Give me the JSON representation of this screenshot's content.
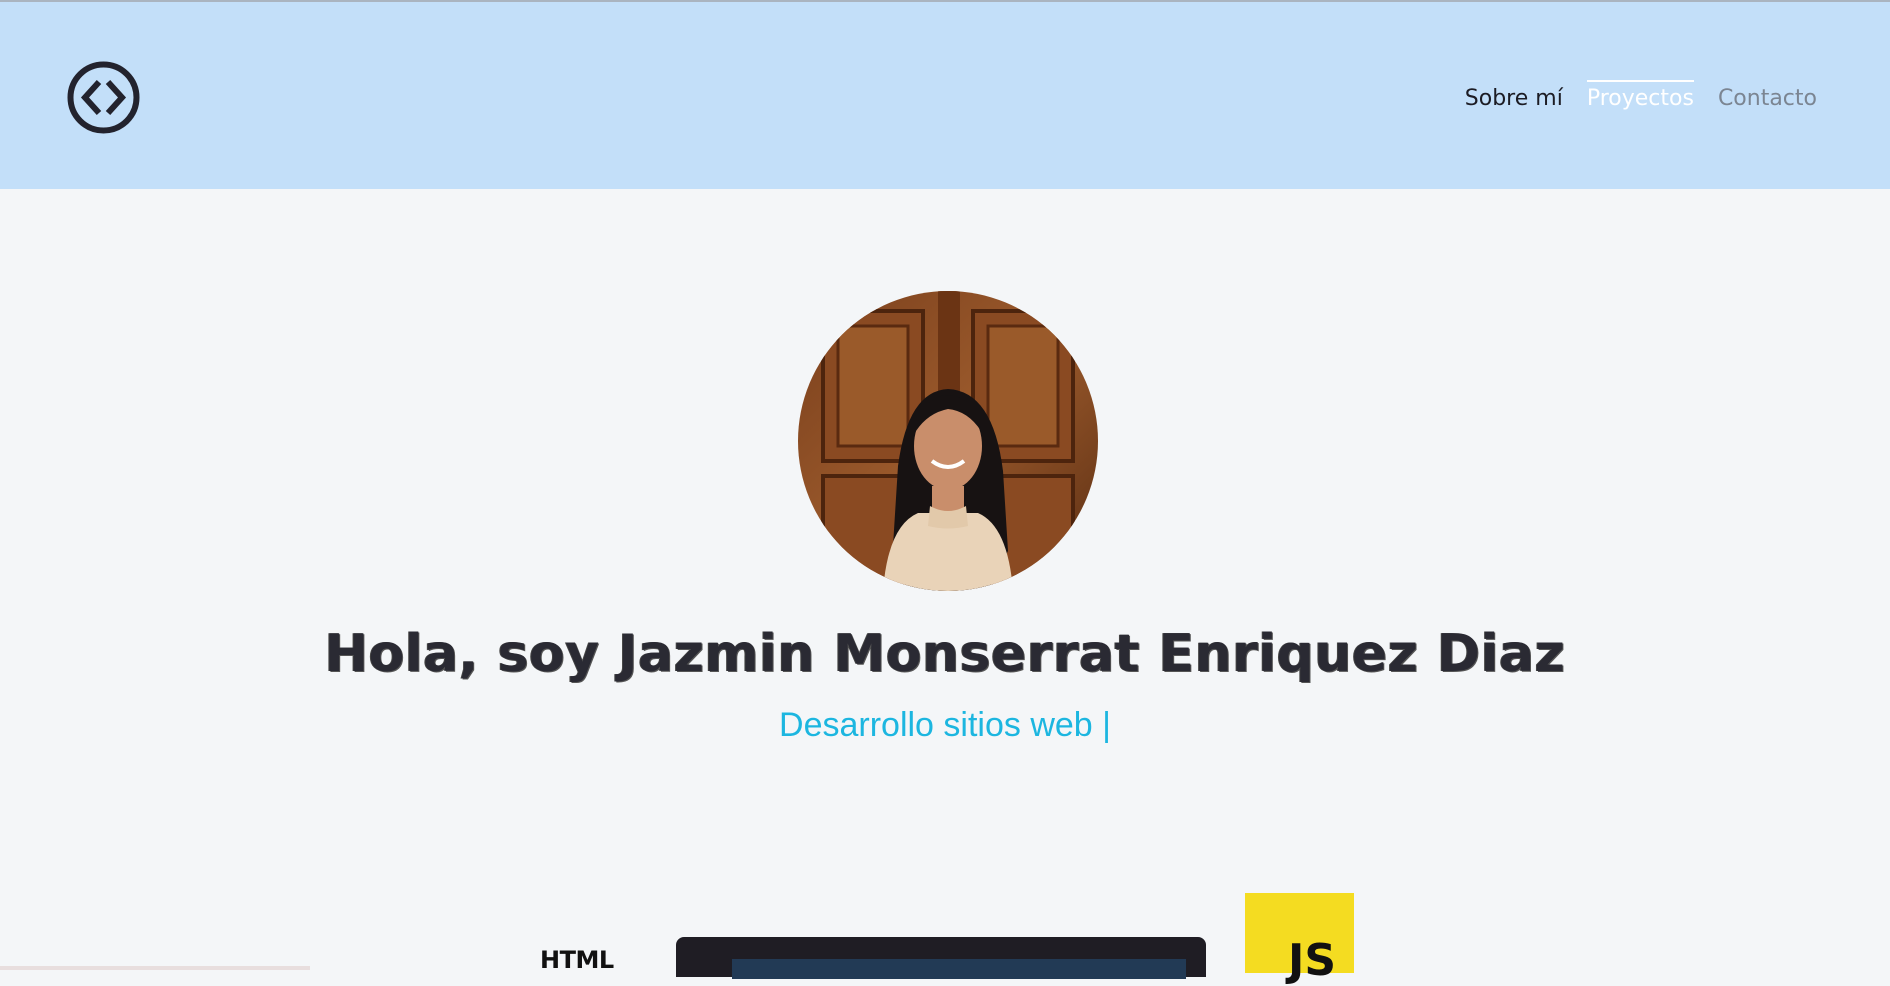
{
  "header": {
    "logo_icon": "code-brackets-circle-icon",
    "nav": [
      {
        "label": "Sobre mí",
        "state": "default"
      },
      {
        "label": "Proyectos",
        "state": "active"
      },
      {
        "label": "Contacto",
        "state": "muted"
      }
    ]
  },
  "hero": {
    "avatar": "profile-photo",
    "title": "Hola, soy Jazmin Monserrat Enriquez Diaz",
    "subtitle": "Desarrollo sitios web |"
  },
  "skills": {
    "html_label": "HTML",
    "js_label": "JS"
  },
  "colors": {
    "header_bg": "#c3dff9",
    "page_bg": "#f4f6f8",
    "accent": "#1cb6e0",
    "js_yellow": "#f4dc21"
  }
}
